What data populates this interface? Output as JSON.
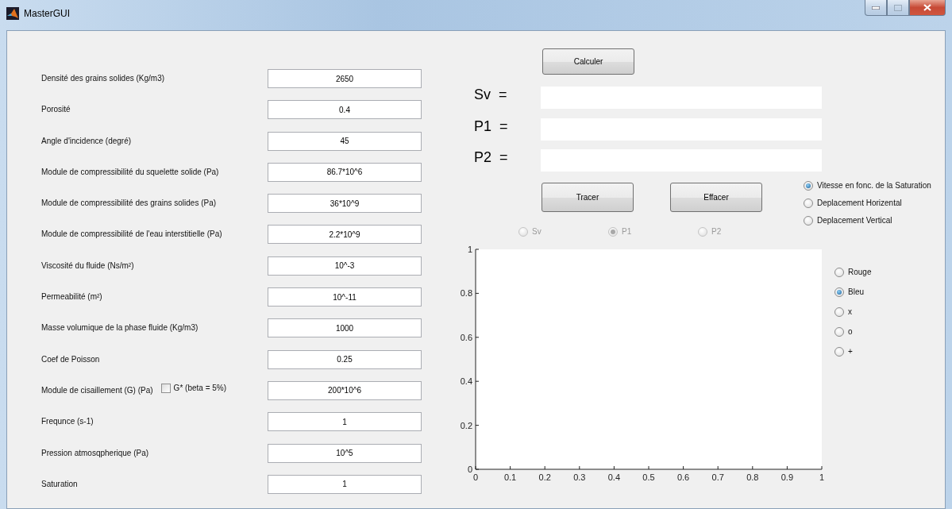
{
  "window": {
    "title": "MasterGUI"
  },
  "parameters": [
    {
      "label": "Densité des grains solides (Kg/m3)",
      "value": "2650"
    },
    {
      "label": "Porosité",
      "value": "0.4"
    },
    {
      "label": "Angle d'incidence (degré)",
      "value": "45"
    },
    {
      "label": "Module de compressibilité du squelette solide (Pa)",
      "value": "86.7*10^6"
    },
    {
      "label": "Module de compressibilité des grains solides (Pa)",
      "value": "36*10^9"
    },
    {
      "label": "Module de compressibilité de l'eau interstitielle (Pa)",
      "value": "2.2*10^9"
    },
    {
      "label": "Viscosité du fluide (Ns/m²)",
      "value": "10^-3"
    },
    {
      "label": "Permeabilité (m²)",
      "value": "10^-11"
    },
    {
      "label": "Masse volumique de la phase fluide (Kg/m3)",
      "value": "1000"
    },
    {
      "label": "Coef de Poisson",
      "value": "0.25"
    },
    {
      "label": "Module de cisaillement (G) (Pa)",
      "value": "200*10^6",
      "checkbox": {
        "label": "G* (beta = 5%)",
        "checked": false
      }
    },
    {
      "label": "Frequnce (s-1)",
      "value": "1"
    },
    {
      "label": "Pression atmosqpherique (Pa)",
      "value": "10^5"
    },
    {
      "label": "Saturation",
      "value": "1"
    }
  ],
  "calculate_button": "Calculer",
  "results": [
    {
      "label": "Sv",
      "sign": "="
    },
    {
      "label": "P1",
      "sign": "="
    },
    {
      "label": "P2",
      "sign": "="
    }
  ],
  "plot_buttons": [
    "Tracer",
    "Effacer"
  ],
  "output_choice": [
    {
      "label": "Sv",
      "selected": false,
      "disabled": true
    },
    {
      "label": "P1",
      "selected": true,
      "disabled": true
    },
    {
      "label": "P2",
      "selected": false,
      "disabled": true
    }
  ],
  "plot_type": [
    {
      "label": "Vitesse en fonc. de la Saturation",
      "selected": true
    },
    {
      "label": "Deplacement Horizental",
      "selected": false
    },
    {
      "label": "Deplacement Vertical",
      "selected": false
    }
  ],
  "style_options": [
    {
      "label": "Rouge",
      "selected": false
    },
    {
      "label": "Bleu",
      "selected": true
    },
    {
      "label": "x",
      "selected": false
    },
    {
      "label": "o",
      "selected": false
    },
    {
      "label": "+",
      "selected": false
    }
  ],
  "chart_data": {
    "type": "line",
    "xlim": [
      0,
      1
    ],
    "ylim": [
      0,
      1
    ],
    "xticks": [
      0,
      0.1,
      0.2,
      0.3,
      0.4,
      0.5,
      0.6,
      0.7,
      0.8,
      0.9,
      1
    ],
    "yticks": [
      0,
      0.2,
      0.4,
      0.6,
      0.8,
      1
    ]
  }
}
